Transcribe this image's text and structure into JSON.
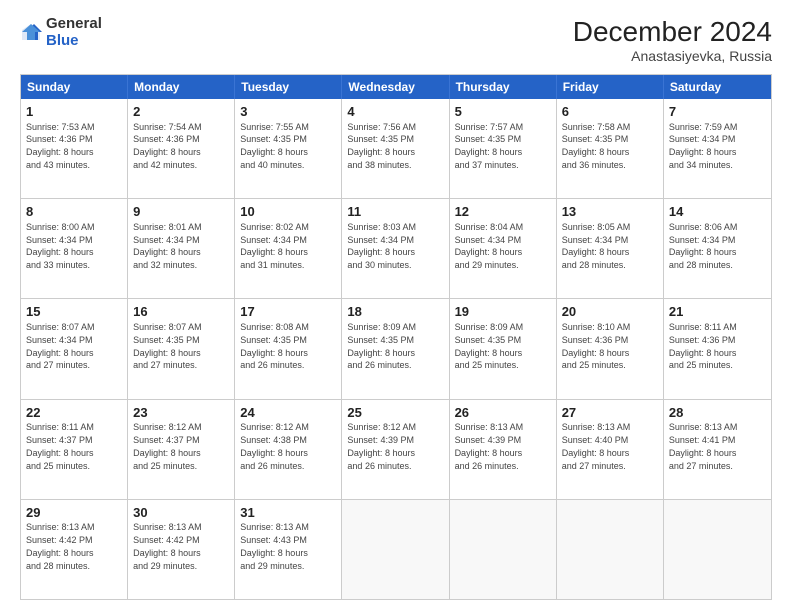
{
  "logo": {
    "general": "General",
    "blue": "Blue"
  },
  "header": {
    "month": "December 2024",
    "location": "Anastasiyevka, Russia"
  },
  "weekdays": [
    "Sunday",
    "Monday",
    "Tuesday",
    "Wednesday",
    "Thursday",
    "Friday",
    "Saturday"
  ],
  "rows": [
    [
      {
        "day": "1",
        "sunrise": "7:53 AM",
        "sunset": "4:36 PM",
        "daylight": "8 hours and 43 minutes."
      },
      {
        "day": "2",
        "sunrise": "7:54 AM",
        "sunset": "4:36 PM",
        "daylight": "8 hours and 42 minutes."
      },
      {
        "day": "3",
        "sunrise": "7:55 AM",
        "sunset": "4:35 PM",
        "daylight": "8 hours and 40 minutes."
      },
      {
        "day": "4",
        "sunrise": "7:56 AM",
        "sunset": "4:35 PM",
        "daylight": "8 hours and 38 minutes."
      },
      {
        "day": "5",
        "sunrise": "7:57 AM",
        "sunset": "4:35 PM",
        "daylight": "8 hours and 37 minutes."
      },
      {
        "day": "6",
        "sunrise": "7:58 AM",
        "sunset": "4:35 PM",
        "daylight": "8 hours and 36 minutes."
      },
      {
        "day": "7",
        "sunrise": "7:59 AM",
        "sunset": "4:34 PM",
        "daylight": "8 hours and 34 minutes."
      }
    ],
    [
      {
        "day": "8",
        "sunrise": "8:00 AM",
        "sunset": "4:34 PM",
        "daylight": "8 hours and 33 minutes."
      },
      {
        "day": "9",
        "sunrise": "8:01 AM",
        "sunset": "4:34 PM",
        "daylight": "8 hours and 32 minutes."
      },
      {
        "day": "10",
        "sunrise": "8:02 AM",
        "sunset": "4:34 PM",
        "daylight": "8 hours and 31 minutes."
      },
      {
        "day": "11",
        "sunrise": "8:03 AM",
        "sunset": "4:34 PM",
        "daylight": "8 hours and 30 minutes."
      },
      {
        "day": "12",
        "sunrise": "8:04 AM",
        "sunset": "4:34 PM",
        "daylight": "8 hours and 29 minutes."
      },
      {
        "day": "13",
        "sunrise": "8:05 AM",
        "sunset": "4:34 PM",
        "daylight": "8 hours and 28 minutes."
      },
      {
        "day": "14",
        "sunrise": "8:06 AM",
        "sunset": "4:34 PM",
        "daylight": "8 hours and 28 minutes."
      }
    ],
    [
      {
        "day": "15",
        "sunrise": "8:07 AM",
        "sunset": "4:34 PM",
        "daylight": "8 hours and 27 minutes."
      },
      {
        "day": "16",
        "sunrise": "8:07 AM",
        "sunset": "4:35 PM",
        "daylight": "8 hours and 27 minutes."
      },
      {
        "day": "17",
        "sunrise": "8:08 AM",
        "sunset": "4:35 PM",
        "daylight": "8 hours and 26 minutes."
      },
      {
        "day": "18",
        "sunrise": "8:09 AM",
        "sunset": "4:35 PM",
        "daylight": "8 hours and 26 minutes."
      },
      {
        "day": "19",
        "sunrise": "8:09 AM",
        "sunset": "4:35 PM",
        "daylight": "8 hours and 25 minutes."
      },
      {
        "day": "20",
        "sunrise": "8:10 AM",
        "sunset": "4:36 PM",
        "daylight": "8 hours and 25 minutes."
      },
      {
        "day": "21",
        "sunrise": "8:11 AM",
        "sunset": "4:36 PM",
        "daylight": "8 hours and 25 minutes."
      }
    ],
    [
      {
        "day": "22",
        "sunrise": "8:11 AM",
        "sunset": "4:37 PM",
        "daylight": "8 hours and 25 minutes."
      },
      {
        "day": "23",
        "sunrise": "8:12 AM",
        "sunset": "4:37 PM",
        "daylight": "8 hours and 25 minutes."
      },
      {
        "day": "24",
        "sunrise": "8:12 AM",
        "sunset": "4:38 PM",
        "daylight": "8 hours and 26 minutes."
      },
      {
        "day": "25",
        "sunrise": "8:12 AM",
        "sunset": "4:39 PM",
        "daylight": "8 hours and 26 minutes."
      },
      {
        "day": "26",
        "sunrise": "8:13 AM",
        "sunset": "4:39 PM",
        "daylight": "8 hours and 26 minutes."
      },
      {
        "day": "27",
        "sunrise": "8:13 AM",
        "sunset": "4:40 PM",
        "daylight": "8 hours and 27 minutes."
      },
      {
        "day": "28",
        "sunrise": "8:13 AM",
        "sunset": "4:41 PM",
        "daylight": "8 hours and 27 minutes."
      }
    ],
    [
      {
        "day": "29",
        "sunrise": "8:13 AM",
        "sunset": "4:42 PM",
        "daylight": "8 hours and 28 minutes."
      },
      {
        "day": "30",
        "sunrise": "8:13 AM",
        "sunset": "4:42 PM",
        "daylight": "8 hours and 29 minutes."
      },
      {
        "day": "31",
        "sunrise": "8:13 AM",
        "sunset": "4:43 PM",
        "daylight": "8 hours and 29 minutes."
      },
      null,
      null,
      null,
      null
    ]
  ],
  "labels": {
    "sunrise": "Sunrise:",
    "sunset": "Sunset:",
    "daylight": "Daylight:"
  }
}
